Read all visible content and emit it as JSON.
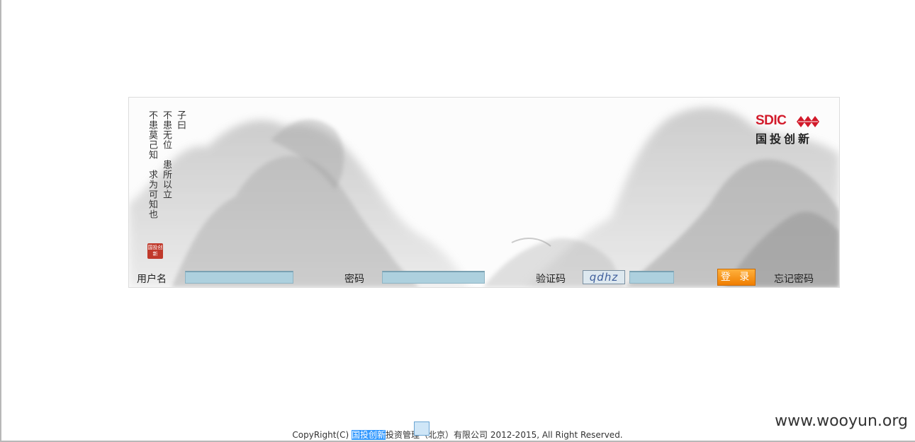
{
  "panel": {
    "poem": {
      "col1": "子曰",
      "col2": "不患无位　患所以立",
      "col3": "不患莫己知　求为可知也",
      "seal": "国投创新"
    },
    "logo": {
      "en": "SDIC",
      "cn": "国投创新",
      "brand_color": "#d21a2a"
    }
  },
  "form": {
    "username_label": "用户名",
    "password_label": "密码",
    "captcha_label": "验证码",
    "captcha_text": "qdhz",
    "login_button": "登 录",
    "forgot_link": "忘记密码"
  },
  "footer": {
    "prefix": "CopyRight(C) ",
    "highlight": "国投创新",
    "rest": "投资管理（北京）有限公司  2012-2015, All Right Reserved."
  },
  "watermark": "www.wooyun.org"
}
